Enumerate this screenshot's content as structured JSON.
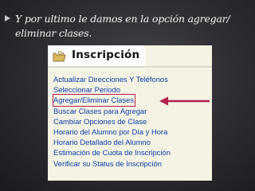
{
  "slide": {
    "text": "Y por ultimo le damos en la opción  agregar/ eliminar clases."
  },
  "panel": {
    "title": "Inscripción",
    "icon": "folder-hand-icon",
    "items": [
      "Actualizar Direcciones Y Teléfonos",
      "Seleccionar Periodo",
      "Agregar/Eliminar Clases",
      "Buscar Clases para Agregar",
      "Cambiar Opciones de Clase",
      "Horario del Alumno por Día y Hora",
      "Horario Detallado del Alumno",
      "Estimación de Cuota de Inscripción",
      "Verificar su Status de Inscripción"
    ],
    "highlighted_item": "Agregar/Eliminar Clases"
  },
  "colors": {
    "background": "#2f2f34",
    "link": "#0b3ea8",
    "highlight": "#b3214e",
    "panel": "#f4f3e4"
  }
}
